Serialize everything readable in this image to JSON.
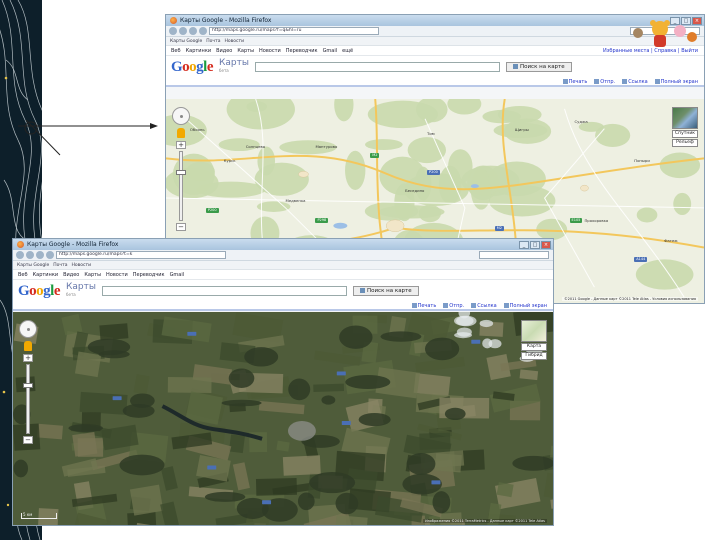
{
  "top_window": {
    "title": "Карты Google - Mozilla Firefox",
    "url": "http://maps.google.ru/maps?f=q&hl=ru",
    "bookmarks": [
      "Карты Google",
      "Почта",
      "Новости"
    ],
    "menu": [
      "Веб",
      "Картинки",
      "Видео",
      "Карты",
      "Новости",
      "Переводчик",
      "Gmail",
      "ещё"
    ],
    "menu_right": "Избранные места | Справка | Выйти",
    "search_button": "Поиск на карте",
    "links": [
      "Печать",
      "Отпр.",
      "Ссылка",
      "Полный экран"
    ],
    "map_type": "Спутник",
    "map_type_secondary": "Рельеф",
    "scale_label": "5 км",
    "copyright": "©2011 Google - Данные карт ©2011 Tele Atlas - Условия использования",
    "map_mode": "map",
    "zoom_level": 0.72
  },
  "bottom_window": {
    "title": "Карты Google - Mozilla Firefox",
    "url": "http://maps.google.ru/maps?t=k",
    "bookmarks": [
      "Карты Google",
      "Почта",
      "Новости"
    ],
    "menu": [
      "Веб",
      "Картинки",
      "Видео",
      "Карты",
      "Новости",
      "Переводчик",
      "Gmail"
    ],
    "search_button": "Поиск на карте",
    "links": [
      "Печать",
      "Отпр.",
      "Ссылка",
      "Полный экран"
    ],
    "map_type": "Карта",
    "map_type_secondary": "Гибрид",
    "scale_label": "5 км",
    "copyright": "Изображения ©2011 TerraMetrics - Данные карт ©2011 Tele Atlas",
    "map_mode": "satellite",
    "zoom_level": 0.72
  },
  "logo": {
    "letters": [
      "G",
      "o",
      "o",
      "g",
      "l",
      "e"
    ],
    "product": "Карты",
    "beta": "бета"
  },
  "top_map_labels": [
    "Курск",
    "Обоянь",
    "Солнцево",
    "Мантурово",
    "Тим",
    "Щигры",
    "Суджа",
    "Беседино",
    "Медвенка",
    "Прохоровка",
    "Пристень",
    "Горшечное",
    "Поныри",
    "Фатеж"
  ],
  "top_road_shields": [
    "M2",
    "P200",
    "E105",
    "M2",
    "P298",
    "A144",
    "P200"
  ],
  "colors": {
    "map_bg": "#eef0e2",
    "forest": "#c9d9ad",
    "water": "#9cbfe6",
    "road_major": "#f3c75c",
    "road_minor": "#ffffff",
    "satellite_dark": "#2f3b26",
    "satellite_mid": "#4f5c3a",
    "shield_green": "#3a9b4a",
    "shield_blue": "#4a6fb5"
  }
}
